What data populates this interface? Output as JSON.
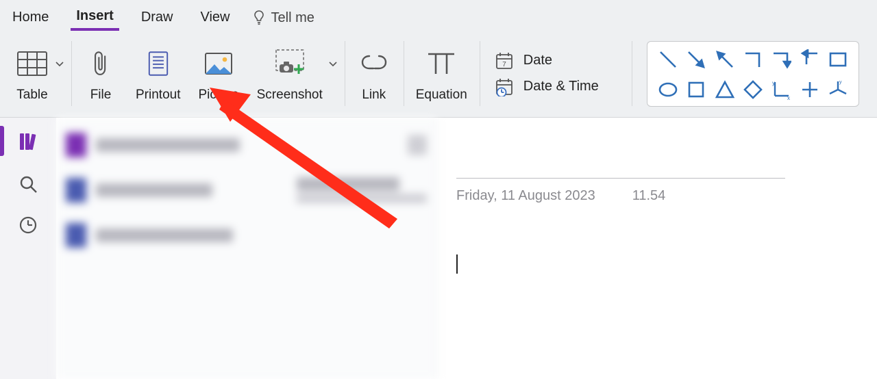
{
  "tabs": {
    "home": "Home",
    "insert": "Insert",
    "draw": "Draw",
    "view": "View",
    "tell_me": "Tell me",
    "active": "insert"
  },
  "ribbon": {
    "table": "Table",
    "file": "File",
    "printout": "Printout",
    "picture": "Picture",
    "screenshot": "Screenshot",
    "link": "Link",
    "equation": "Equation",
    "date": "Date",
    "date_time": "Date & Time"
  },
  "page": {
    "date": "Friday, 11 August 2023",
    "time": "11.54"
  },
  "colors": {
    "accent": "#7b2fb3",
    "shape": "#2f6fb7",
    "annot": "#ff2d1a"
  }
}
